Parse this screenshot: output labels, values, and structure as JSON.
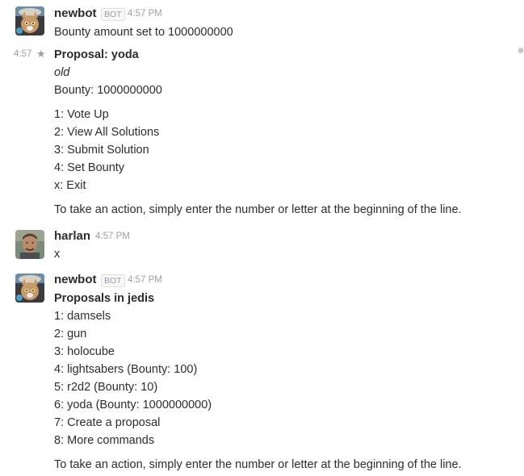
{
  "messages": [
    {
      "author": "newbot",
      "badge": "BOT",
      "time": "4:57 PM",
      "lines": [
        "Bounty amount set to 1000000000"
      ]
    },
    {
      "gutter_time": "4:57",
      "lines": [
        "Proposal: yoda",
        "old",
        "Bounty: 1000000000",
        "1: Vote Up",
        "2: View All Solutions",
        "3: Submit Solution",
        "4: Set Bounty",
        "x: Exit",
        "To take an action, simply enter the number or letter at the beginning of the line."
      ]
    },
    {
      "author": "harlan",
      "time": "4:57 PM",
      "lines": [
        "x"
      ]
    },
    {
      "author": "newbot",
      "badge": "BOT",
      "time": "4:57 PM",
      "lines": [
        "Proposals in jedis",
        "1: damsels",
        "2: gun",
        "3: holocube",
        "4: lightsabers (Bounty: 100)",
        "5: r2d2 (Bounty: 10)",
        "6: yoda (Bounty: 1000000000)",
        "7: Create a proposal",
        "8: More commands",
        "To take an action, simply enter the number or letter at the beginning of the line."
      ]
    }
  ],
  "icons": {
    "star": "star-icon",
    "gear": "gear-icon"
  },
  "colors": {
    "text": "#2c2d30",
    "muted": "#a0a0a2"
  }
}
